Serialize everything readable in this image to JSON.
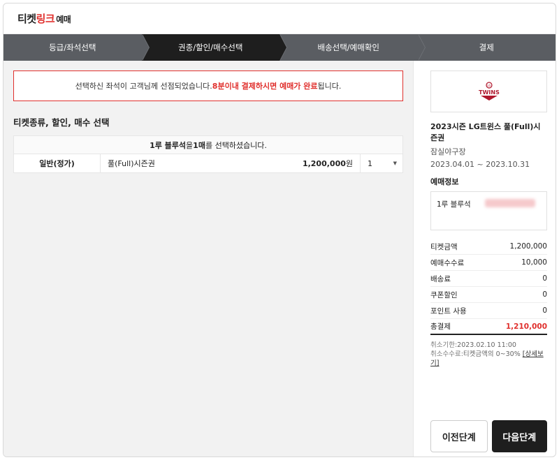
{
  "logo": {
    "part1": "티켓",
    "part2": "링크",
    "part3": "예매"
  },
  "steps": [
    {
      "label": "등급/좌석선택",
      "active": false
    },
    {
      "label": "권종/할인/매수선택",
      "active": true
    },
    {
      "label": "배송선택/예매확인",
      "active": false
    },
    {
      "label": "결제",
      "active": false
    }
  ],
  "notice": {
    "text": "선택하신 좌석이 고객님께 선점되었습니다. ",
    "highlight": "8분이내 결제하시면 예매가 완료",
    "suffix": "됩니다."
  },
  "section_title": "티켓종류, 할인, 매수 선택",
  "table": {
    "head_seat": "1루 블루석",
    "head_mid": "을 ",
    "head_count": "1매",
    "head_suffix": "를 선택하셨습니다.",
    "row": {
      "type": "일반(정가)",
      "name": "풀(Full)시즌권",
      "price": "1,200,000",
      "unit": "원",
      "qty": "1"
    }
  },
  "side": {
    "team_logo": "TWINS",
    "team_logo_small": "LG",
    "title": "2023시즌 LG트윈스 풀(Full)시즌권",
    "venue": "잠실야구장",
    "period": "2023.04.01 ~ 2023.10.31",
    "reservation_title": "예매정보",
    "seat": "1루 블루석",
    "fees": [
      {
        "label": "티켓금액",
        "value": "1,200,000"
      },
      {
        "label": "예매수수료",
        "value": "10,000"
      },
      {
        "label": "배송료",
        "value": "0"
      },
      {
        "label": "쿠폰할인",
        "value": "0"
      },
      {
        "label": "포인트 사용",
        "value": "0"
      }
    ],
    "total_label": "총결제",
    "total_value": "1,210,000",
    "cancel_deadline_label": "취소기한:",
    "cancel_deadline": "2023.02.10 11:00",
    "cancel_fee_label": "취소수수료:",
    "cancel_fee": "티켓금액의 0~30% ",
    "detail_link": "[상세보기]",
    "prev_button": "이전단계",
    "next_button": "다음단계"
  }
}
